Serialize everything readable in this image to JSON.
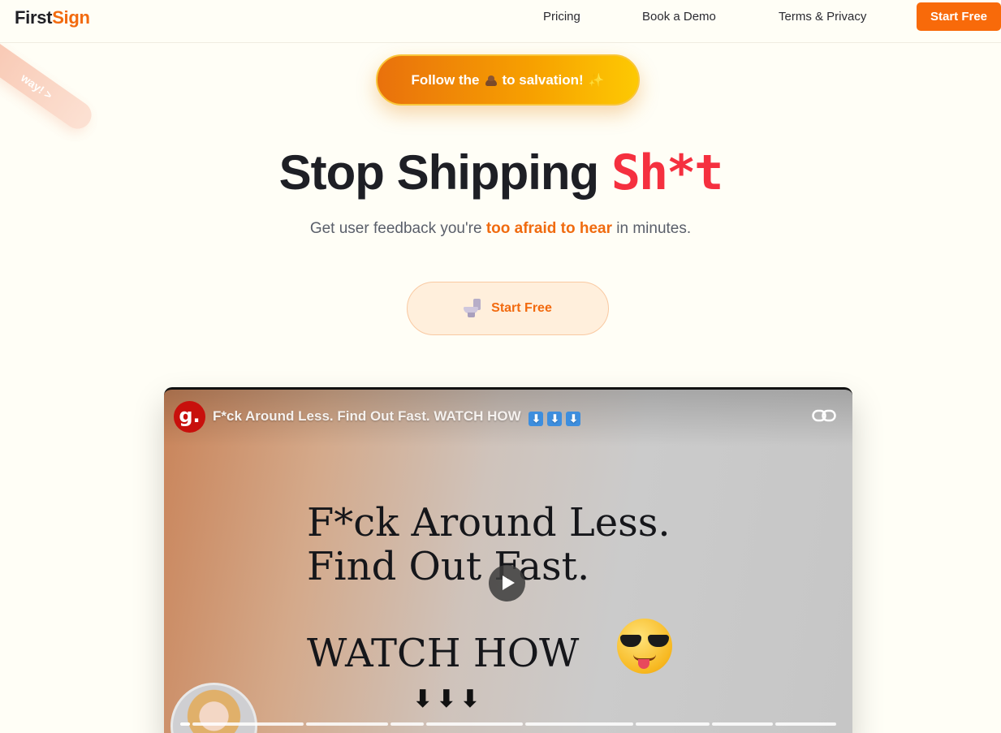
{
  "header": {
    "logo_first": "First",
    "logo_second": "Sign",
    "nav": [
      "Pricing",
      "Book a Demo",
      "Terms & Privacy"
    ],
    "cta_label": "Start Free"
  },
  "ribbon": {
    "text": "way! >"
  },
  "promo": {
    "before": "Follow the",
    "icon": "poop-emoji",
    "after": "to salvation!",
    "sparkle": "✨"
  },
  "hero": {
    "title_main": "Stop Shipping",
    "title_accent": "Sh*t",
    "subtitle_before": "Get user feedback you're",
    "subtitle_highlight": "too afraid to hear",
    "subtitle_after": "in minutes.",
    "cta_label": "Start Free",
    "cta_icon": "toilet-icon"
  },
  "video": {
    "channel_letter": "g.",
    "title": "F*ck Around Less. Find Out Fast. WATCH HOW",
    "title_arrows": [
      "⬇",
      "⬇",
      "⬇"
    ],
    "headline_line1": "F*ck Around Less.",
    "headline_line2": "Find Out Fast.",
    "watch_text": "WATCH HOW",
    "down_arrows": "⬇⬇⬇",
    "chapter_count": 10
  },
  "colors": {
    "brand_orange": "#f86a0a",
    "accent_red": "#f5303f",
    "background": "#fffef6"
  }
}
